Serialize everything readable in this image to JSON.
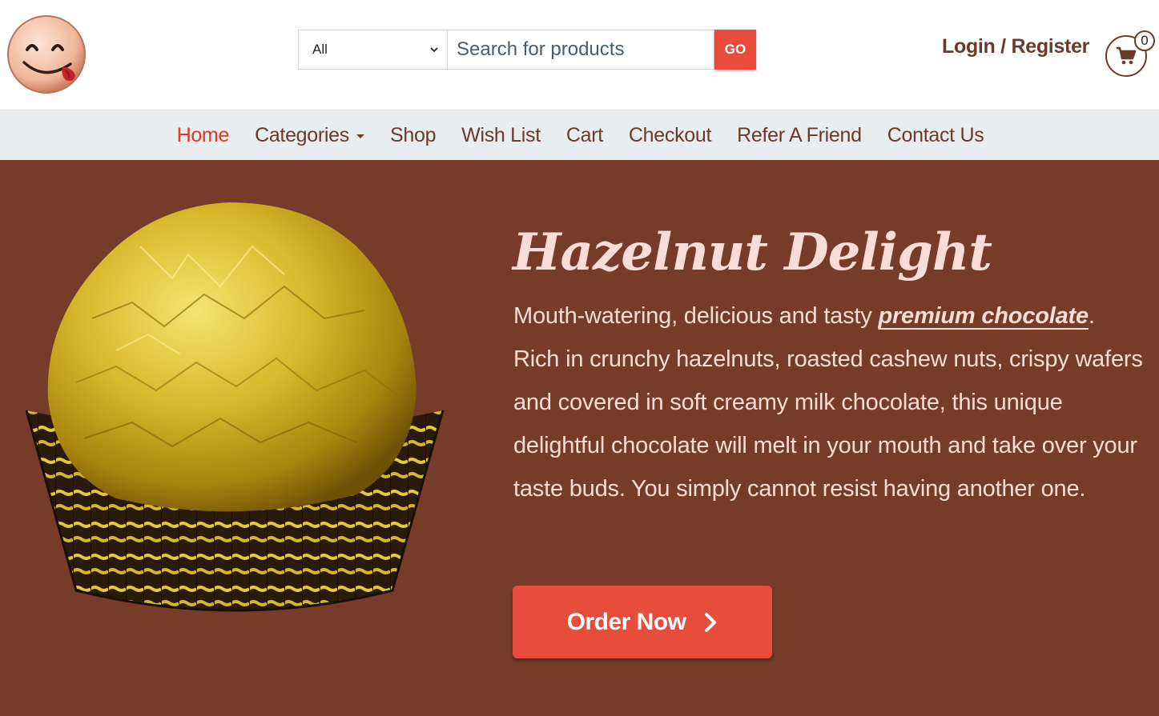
{
  "header": {
    "logo_icon": "smiley-tongue-icon",
    "search": {
      "category_selected": "All",
      "placeholder": "Search for products",
      "go_label": "GO"
    },
    "login_label": "Login / Register",
    "cart": {
      "icon": "shopping-cart-icon",
      "count": "0"
    }
  },
  "nav": {
    "items": [
      {
        "label": "Home",
        "active": true
      },
      {
        "label": "Categories",
        "has_dropdown": true
      },
      {
        "label": "Shop"
      },
      {
        "label": "Wish List"
      },
      {
        "label": "Cart"
      },
      {
        "label": "Checkout"
      },
      {
        "label": "Refer A Friend"
      },
      {
        "label": "Contact Us"
      }
    ]
  },
  "hero": {
    "title": "Hazelnut Delight",
    "text_before": "Mouth-watering, delicious and tasty ",
    "text_emphasis": "premium chocolate",
    "text_after": ". Rich in crunchy hazelnuts, roasted cashew nuts, crispy wafers and covered in soft creamy milk chocolate, this unique delightful chocolate will melt in your mouth and take over your taste buds. You simply cannot resist having another one.",
    "order_label": "Order Now",
    "order_icon": "chevron-right-icon",
    "background_color": "#763c29",
    "accent_color": "#e74c3c"
  }
}
